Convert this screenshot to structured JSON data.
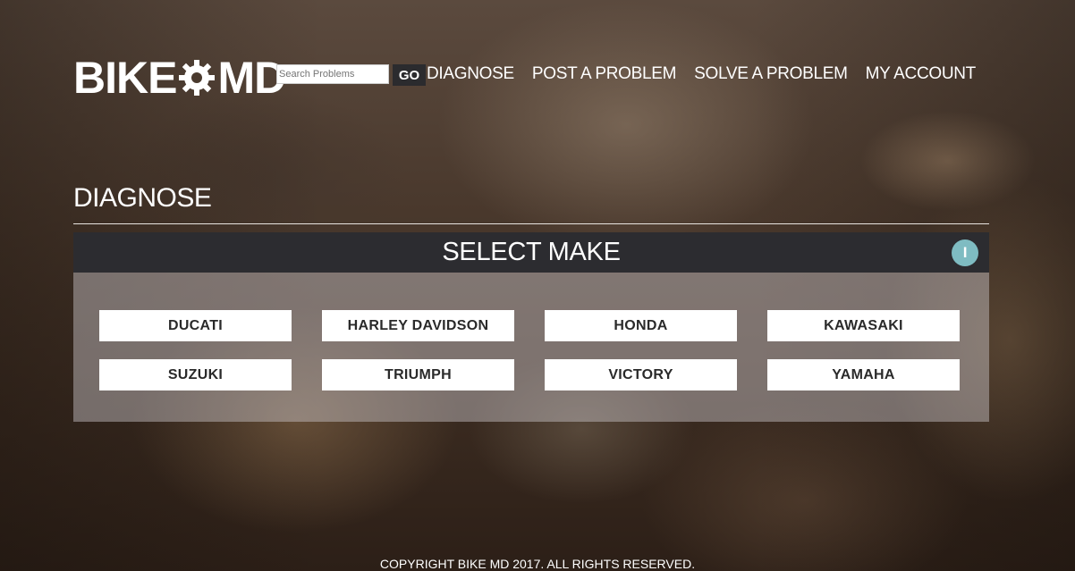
{
  "header": {
    "logo_left": "BIKE",
    "logo_right": "MD",
    "search": {
      "placeholder": "Search Problems",
      "value": ""
    },
    "go_label": "GO",
    "nav": [
      {
        "label": "DIAGNOSE"
      },
      {
        "label": "POST A PROBLEM"
      },
      {
        "label": "SOLVE A PROBLEM"
      },
      {
        "label": "MY ACCOUNT"
      }
    ]
  },
  "page": {
    "title": "DIAGNOSE"
  },
  "panel": {
    "title": "SELECT MAKE",
    "info_label": "I",
    "makes": [
      {
        "label": "DUCATI"
      },
      {
        "label": "HARLEY DAVIDSON"
      },
      {
        "label": "HONDA"
      },
      {
        "label": "KAWASAKI"
      },
      {
        "label": "SUZUKI"
      },
      {
        "label": "TRIUMPH"
      },
      {
        "label": "VICTORY"
      },
      {
        "label": "YAMAHA"
      }
    ]
  },
  "footer": {
    "copyright": "COPYRIGHT BIKE MD 2017. ALL RIGHTS RESERVED."
  },
  "colors": {
    "panel_header": "#2c2c30",
    "info_accent": "#7fbcc2",
    "button_bg": "#ffffff",
    "text_light": "#ffffff"
  }
}
